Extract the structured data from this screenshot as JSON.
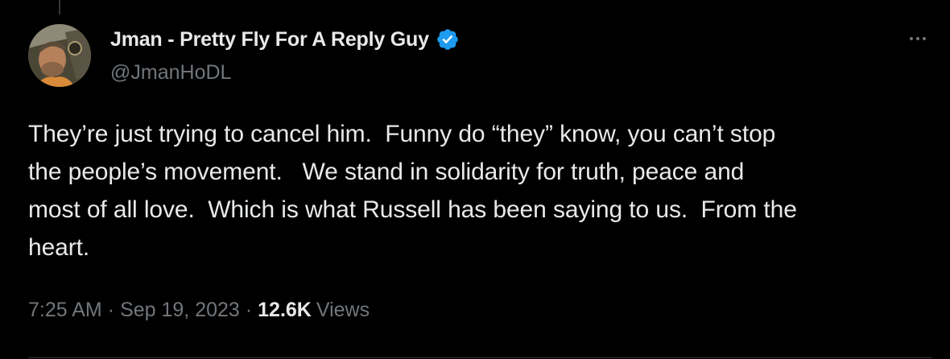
{
  "tweet": {
    "author": {
      "display_name": "Jman - Pretty Fly For A Reply Guy",
      "handle": "@JmanHoDL",
      "verified": true,
      "verified_icon": "verified-badge-icon",
      "avatar": "avatar-photo"
    },
    "text": "They’re just trying to cancel him.  Funny do “they” know, you can’t stop\nthe people’s movement.   We stand in solidarity for truth, peace and\nmost of all love.  Which is what Russell has been saying to us.  From the\nheart.",
    "time": "7:25 AM",
    "date": "Sep 19, 2023",
    "separator": "·",
    "views_count": "12.6K",
    "views_label": "Views",
    "more_icon": "more-horizontal-icon"
  },
  "colors": {
    "background": "#000000",
    "primary_text": "#e7e9ea",
    "secondary_text": "#71767b",
    "verified_blue": "#1d9bf0",
    "divider": "#2f3336"
  }
}
